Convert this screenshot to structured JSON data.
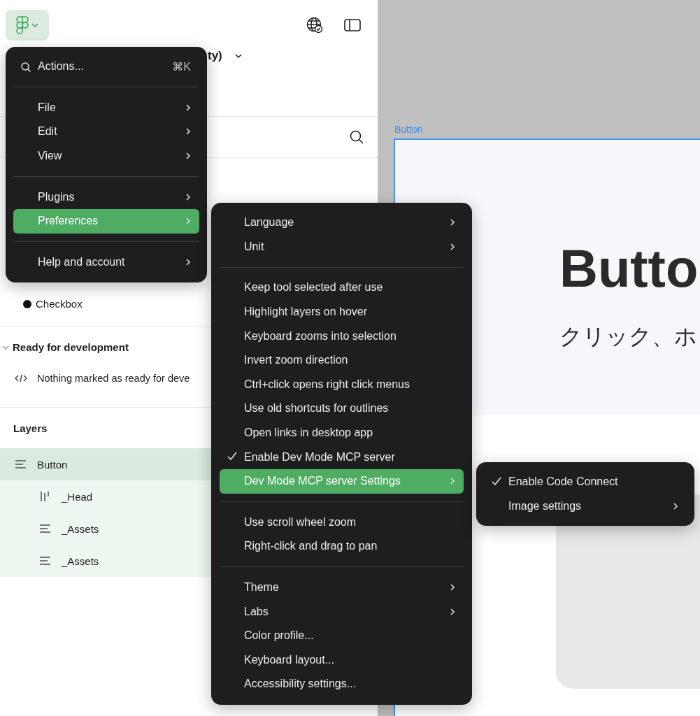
{
  "header": {
    "title_fragment": "ty)"
  },
  "checkbox_item": {
    "label": "Checkbox"
  },
  "ready_section": {
    "title": "Ready for development",
    "expanded": true,
    "empty_text": "Nothing marked as ready for deve"
  },
  "layers": {
    "title": "Layers",
    "items": [
      {
        "name": "Button",
        "kind": "stack",
        "selected": true,
        "children": [
          {
            "name": "_Head",
            "kind": "columns",
            "selected": false
          },
          {
            "name": "_Assets",
            "kind": "stack",
            "selected": false
          },
          {
            "name": "_Assets",
            "kind": "stack",
            "selected": false
          }
        ]
      }
    ]
  },
  "canvas": {
    "frame_label": "Button",
    "heading": "Butto",
    "subtitle": "クリック、ホ"
  },
  "main_menu": {
    "search": {
      "label": "Actions...",
      "shortcut": "⌘K"
    },
    "groups": [
      [
        {
          "label": "File",
          "submenu": true,
          "selected": false
        },
        {
          "label": "Edit",
          "submenu": true,
          "selected": false
        },
        {
          "label": "View",
          "submenu": true,
          "selected": false
        }
      ],
      [
        {
          "label": "Plugins",
          "submenu": true,
          "selected": false
        },
        {
          "label": "Preferences",
          "submenu": true,
          "selected": true
        }
      ],
      [
        {
          "label": "Help and account",
          "submenu": true,
          "selected": false
        }
      ]
    ]
  },
  "preferences_menu": {
    "groups": [
      [
        {
          "label": "Language",
          "submenu": true,
          "selected": false,
          "checked": false
        },
        {
          "label": "Unit",
          "submenu": true,
          "selected": false,
          "checked": false
        }
      ],
      [
        {
          "label": "Keep tool selected after use",
          "submenu": false,
          "selected": false,
          "checked": false
        },
        {
          "label": "Highlight layers on hover",
          "submenu": false,
          "selected": false,
          "checked": false
        },
        {
          "label": "Keyboard zooms into selection",
          "submenu": false,
          "selected": false,
          "checked": false
        },
        {
          "label": "Invert zoom direction",
          "submenu": false,
          "selected": false,
          "checked": false
        },
        {
          "label": "Ctrl+click opens right click menus",
          "submenu": false,
          "selected": false,
          "checked": false
        },
        {
          "label": "Use old shortcuts for outlines",
          "submenu": false,
          "selected": false,
          "checked": false
        },
        {
          "label": "Open links in desktop app",
          "submenu": false,
          "selected": false,
          "checked": false
        },
        {
          "label": "Enable Dev Mode MCP server",
          "submenu": false,
          "selected": false,
          "checked": true
        },
        {
          "label": "Dev Mode MCP server Settings",
          "submenu": true,
          "selected": true,
          "checked": false
        }
      ],
      [
        {
          "label": "Use scroll wheel zoom",
          "submenu": false,
          "selected": false,
          "checked": false
        },
        {
          "label": "Right-click and drag to pan",
          "submenu": false,
          "selected": false,
          "checked": false
        }
      ],
      [
        {
          "label": "Theme",
          "submenu": true,
          "selected": false,
          "checked": false
        },
        {
          "label": "Labs",
          "submenu": true,
          "selected": false,
          "checked": false
        },
        {
          "label": "Color profile...",
          "submenu": false,
          "selected": false,
          "checked": false
        },
        {
          "label": "Keyboard layout...",
          "submenu": false,
          "selected": false,
          "checked": false
        },
        {
          "label": "Accessibility settings...",
          "submenu": false,
          "selected": false,
          "checked": false
        }
      ]
    ]
  },
  "mcp_settings_menu": {
    "groups": [
      [
        {
          "label": "Enable Code Connect",
          "submenu": false,
          "selected": false,
          "checked": true
        },
        {
          "label": "Image settings",
          "submenu": true,
          "selected": false,
          "checked": false
        }
      ]
    ]
  }
}
